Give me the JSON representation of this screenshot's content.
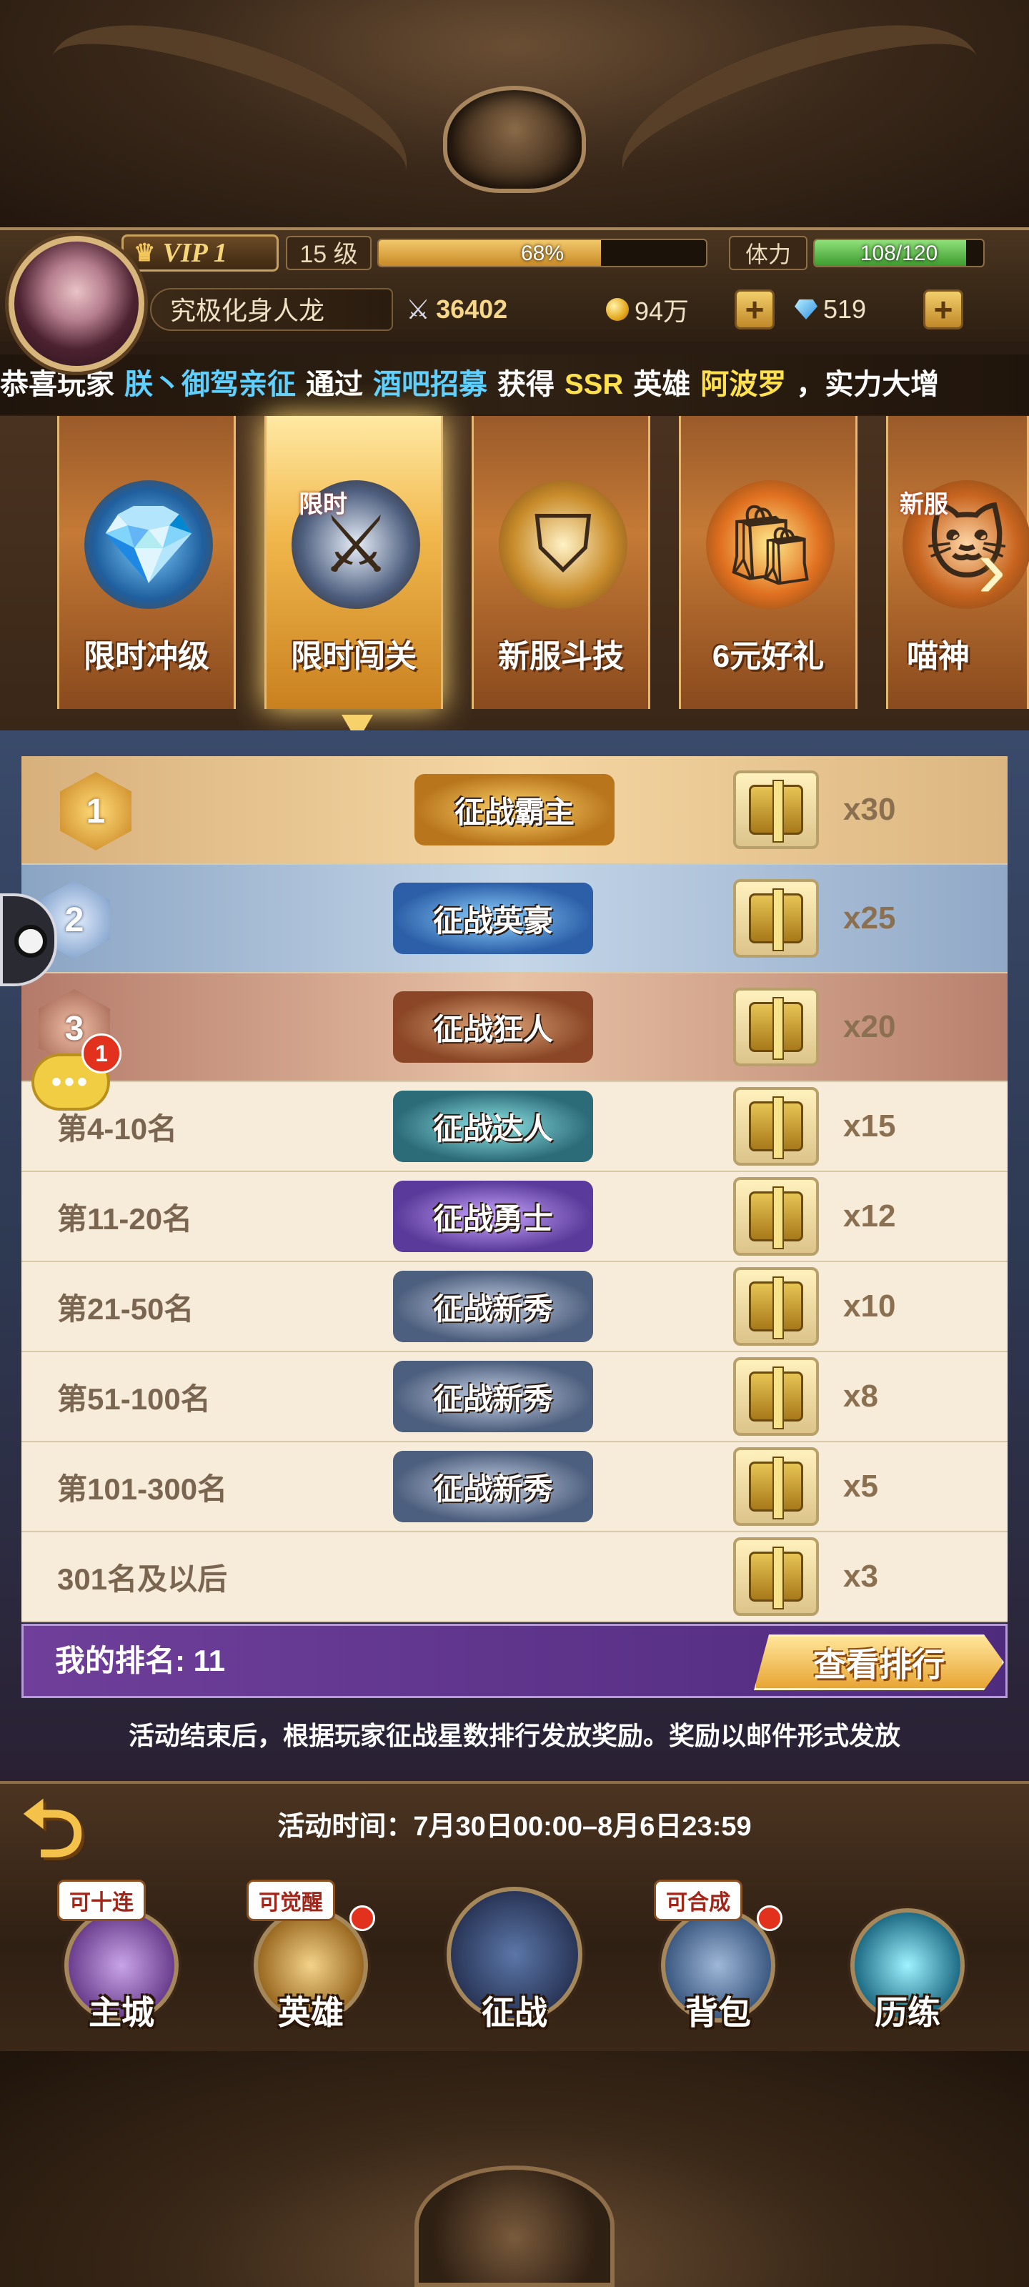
{
  "header": {
    "vip_label": "VIP 1",
    "level": "15 级",
    "xp_percent": 68,
    "xp_text": "68%",
    "stamina_label": "体力",
    "stamina_text": "108/120",
    "stamina_fraction": 0.9,
    "player_name": "究极化身人龙",
    "power": "36402",
    "gold": "94万",
    "gems": "519"
  },
  "marquee": {
    "prefix": "恭喜玩家",
    "player": "朕丶御驾亲征",
    "via": "通过",
    "source": "酒吧招募",
    "got": "获得",
    "rarity": "SSR",
    "hero_word": "英雄",
    "hero": "阿波罗",
    "suffix": "，实力大增"
  },
  "tabs": [
    {
      "label": "限时冲级",
      "icon": "treasure-chest-icon"
    },
    {
      "label": "限时闯关",
      "icon": "crossed-swords-shield-icon",
      "tag": "限时",
      "active": true
    },
    {
      "label": "新服斗技",
      "icon": "winged-emblem-icon"
    },
    {
      "label": "6元好礼",
      "icon": "gift-bag-icon"
    },
    {
      "label": "喵神",
      "icon": "cat-icon",
      "tag": "新服"
    }
  ],
  "rewards": [
    {
      "rank": "1",
      "title": "征战霸主",
      "qty": "x30",
      "style": "gold"
    },
    {
      "rank": "2",
      "title": "征战英豪",
      "qty": "x25",
      "style": "blue"
    },
    {
      "rank": "3",
      "title": "征战狂人",
      "qty": "x20",
      "style": "copper"
    },
    {
      "rank": "第4-10名",
      "title": "征战达人",
      "qty": "x15",
      "style": "teal"
    },
    {
      "rank": "第11-20名",
      "title": "征战勇士",
      "qty": "x12",
      "style": "purple"
    },
    {
      "rank": "第21-50名",
      "title": "征战新秀",
      "qty": "x10",
      "style": "steel"
    },
    {
      "rank": "第51-100名",
      "title": "征战新秀",
      "qty": "x8",
      "style": "steel"
    },
    {
      "rank": "第101-300名",
      "title": "征战新秀",
      "qty": "x5",
      "style": "steel"
    },
    {
      "rank": "301名及以后",
      "title": "",
      "qty": "x3",
      "style": "none"
    }
  ],
  "my_rank": {
    "label": "我的排名: 11",
    "button": "查看排行"
  },
  "note": "活动结束后，根据玩家征战星数排行发放奖励。奖励以邮件形式发放",
  "chat_badge": "1",
  "event_time": "活动时间：7月30日00:00–8月6日23:59",
  "nav": [
    {
      "label": "主城",
      "tag": "可十连"
    },
    {
      "label": "英雄",
      "tag": "可觉醒"
    },
    {
      "label": "征战",
      "tag": ""
    },
    {
      "label": "背包",
      "tag": "可合成"
    },
    {
      "label": "历练",
      "tag": ""
    }
  ],
  "colors": {
    "accent_gold": "#f1b84d",
    "highlight_blue": "#5fd0ff",
    "highlight_yellow": "#ffe14d",
    "purple_bar": "#6f3f9a"
  }
}
